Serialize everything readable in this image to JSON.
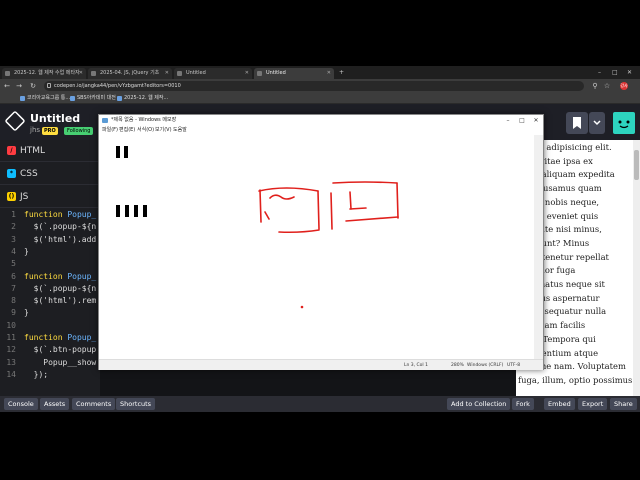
{
  "browser": {
    "tabs": [
      {
        "label": "2025-12. 웹 제작 수업 메타자"
      },
      {
        "label": "2025-04. JS, jQuery 기초"
      },
      {
        "label": "Untitled"
      },
      {
        "label": "Untitled"
      }
    ],
    "url": "codepen.io/jangka44/pen/vYzbgamt?editors=0010",
    "bookmarks": [
      {
        "label": "코리아교육그룹 통..."
      },
      {
        "label": "SBS아카데미 대전"
      },
      {
        "label": "2025-12. 웹 제작..."
      }
    ],
    "profile_initials": "강사"
  },
  "codepen": {
    "title": "Untitled",
    "user": "jhs",
    "pro_badge": "PRO",
    "follow_label": "Following",
    "editor_tabs": [
      {
        "label": "HTML",
        "icon": "html-icon",
        "color": "#ff3c41"
      },
      {
        "label": "CSS",
        "icon": "css-icon",
        "color": "#0ebeff"
      },
      {
        "label": "JS",
        "icon": "js-icon",
        "color": "#fcd000"
      }
    ],
    "code_lines": [
      {
        "n": "1",
        "text": "function Popup_"
      },
      {
        "n": "2",
        "text": "  $(`.popup-${n"
      },
      {
        "n": "3",
        "text": "  $('html').add"
      },
      {
        "n": "4",
        "text": "}"
      },
      {
        "n": "5",
        "text": ""
      },
      {
        "n": "6",
        "text": "function Popup_"
      },
      {
        "n": "7",
        "text": "  $(`.popup-${n"
      },
      {
        "n": "8",
        "text": "  $('html').rem"
      },
      {
        "n": "9",
        "text": "}"
      },
      {
        "n": "10",
        "text": ""
      },
      {
        "n": "11",
        "text": "function Popup_"
      },
      {
        "n": "12",
        "text": "  $(`.btn-popup"
      },
      {
        "n": "13",
        "text": "    Popup__show"
      },
      {
        "n": "14",
        "text": "  });"
      }
    ],
    "preview_lines": [
      "ctetur adipisicing elit.",
      "ptio, vitae ipsa ex",
      "tates aliquam expedita",
      "m accusamus quam",
      "simos nobis neque,",
      "atibus eveniet quis",
      "oluptate nisi minus,",
      "deserunt? Minus",
      "esse, tenetur repellat",
      "tio dolor fuga",
      "e, ut natus neque sit",
      "itatibus aspernatur",
      "nt consequatur nulla",
      "cto quam facilis",
      "sunt! Tempora qui",
      "praesentium atque",
      "maxime nam. Voluptatem",
      "fuga, illum, optio possimus"
    ],
    "footer_left": [
      "Console",
      "Assets",
      "Comments",
      "Shortcuts"
    ],
    "footer_right": [
      "Add to Collection",
      "Fork",
      "Embed",
      "Export",
      "Share"
    ]
  },
  "notepad": {
    "title": "*제목 없음 - Windows 메모장",
    "menu": [
      "파일(F)",
      "편집(E)",
      "서식(O)",
      "보기(V)",
      "도움말"
    ],
    "status": {
      "position": "Ln 3, Col 1",
      "zoom": "280%",
      "line_ending": "Windows (CRLF)",
      "encoding": "UTF-8"
    },
    "annotation_color": "#e0201c"
  }
}
